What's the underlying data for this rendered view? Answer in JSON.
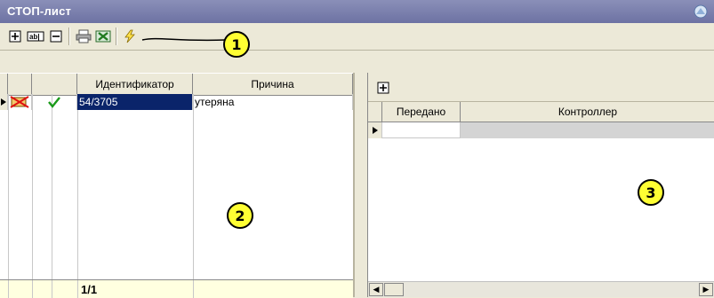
{
  "window": {
    "title": "СТОП-лист"
  },
  "toolbar": {
    "buttons": [
      {
        "name": "add-button",
        "icon": "plus-icon"
      },
      {
        "name": "rename-button",
        "icon": "text-field-icon"
      },
      {
        "name": "remove-button",
        "icon": "minus-icon"
      },
      {
        "name": "print-button",
        "icon": "printer-icon"
      },
      {
        "name": "excel-button",
        "icon": "excel-icon"
      },
      {
        "name": "execute-button",
        "icon": "lightning-icon"
      }
    ]
  },
  "callouts": [
    "1",
    "2",
    "3"
  ],
  "left_grid": {
    "columns": [
      "Идентификатор",
      "Причина"
    ],
    "rows": [
      {
        "identifier": "54/3705",
        "reason": "утеряна"
      }
    ],
    "footer_count": "1/1"
  },
  "right_grid": {
    "columns": [
      "Передано",
      "Контроллер"
    ]
  },
  "colors": {
    "title_bar": "#7b80ad",
    "selection": "#0a246a",
    "callout": "#ffff33"
  }
}
